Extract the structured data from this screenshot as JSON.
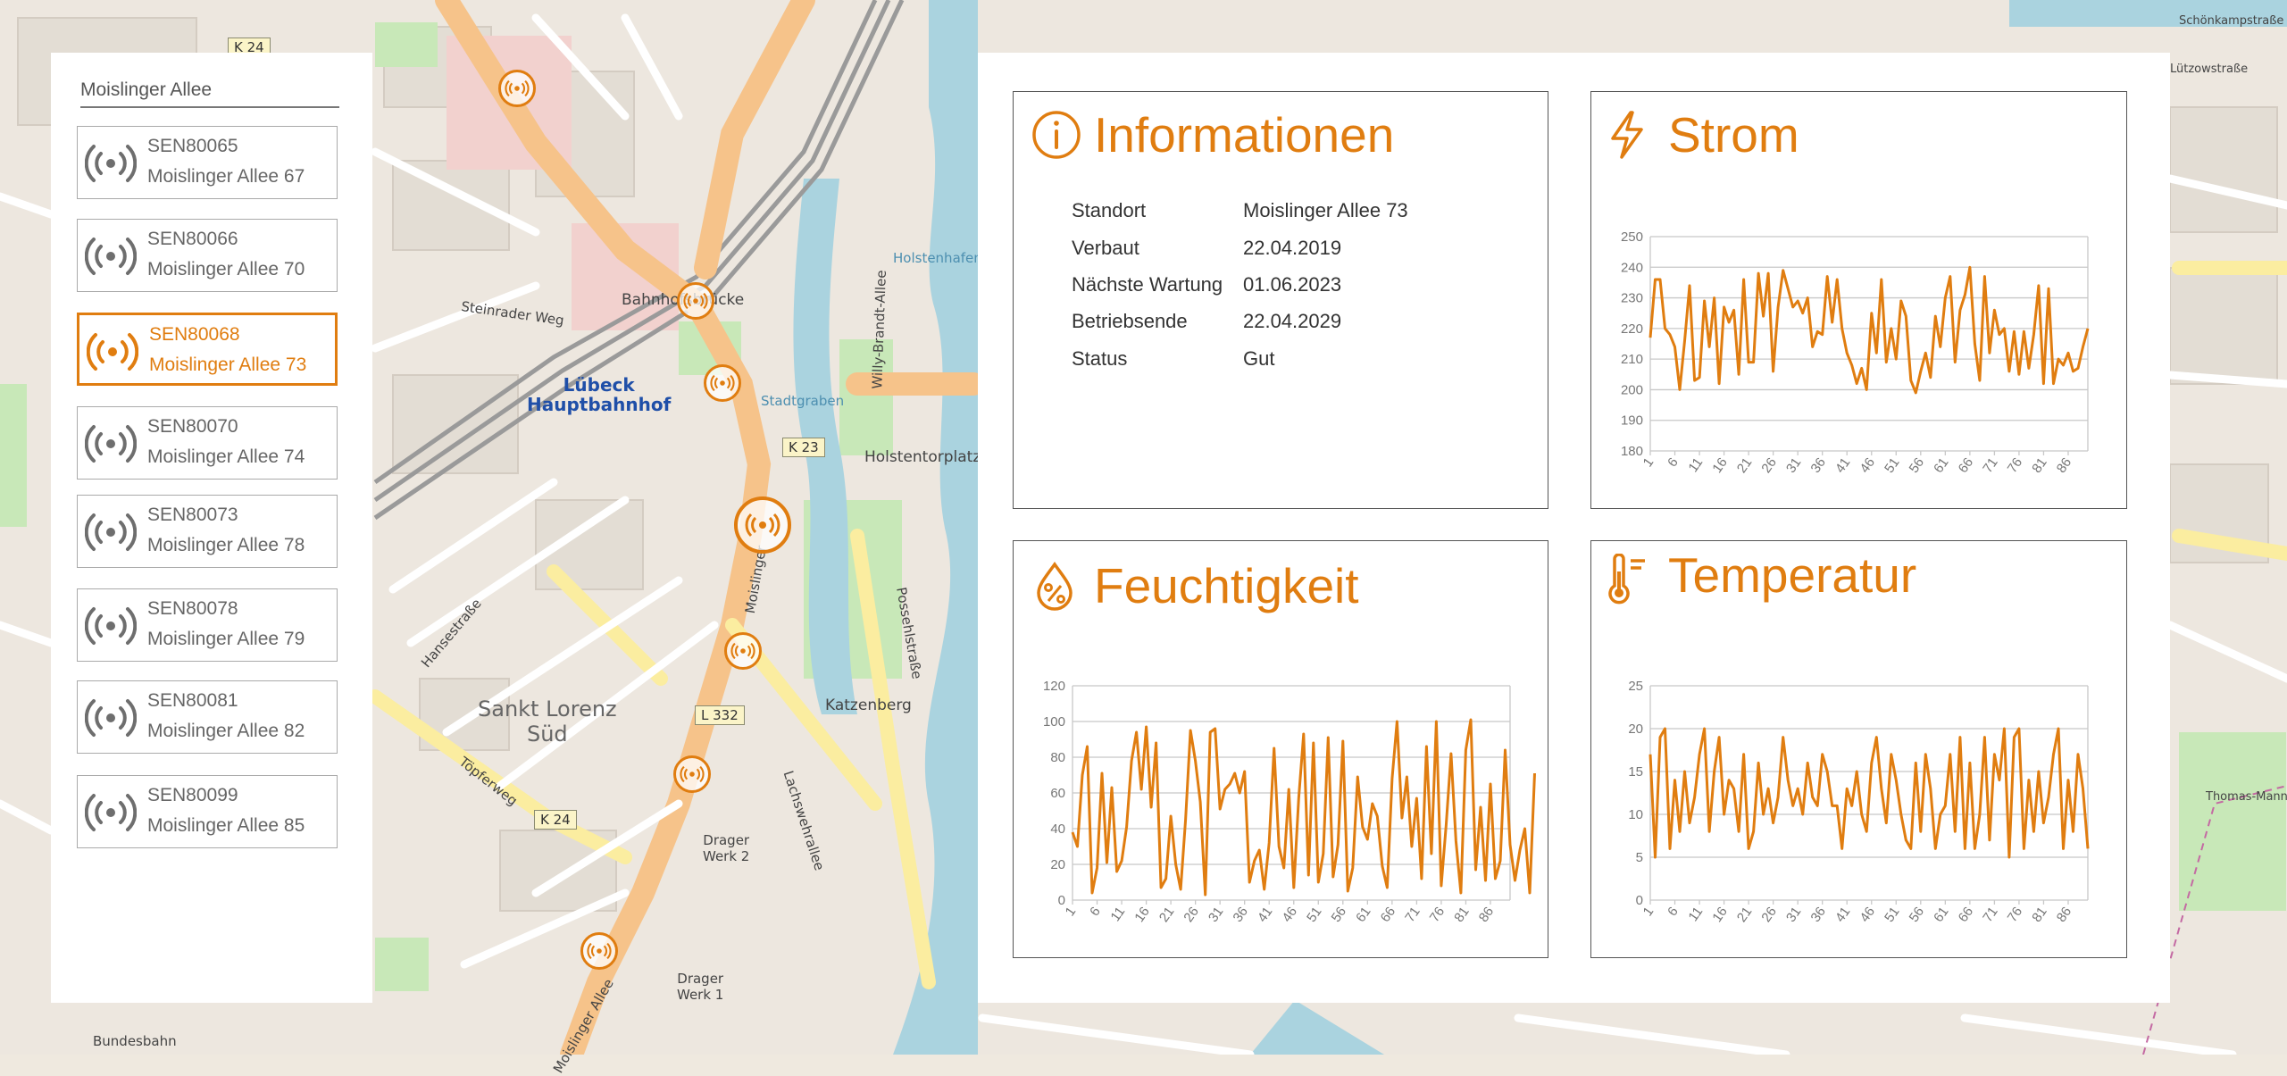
{
  "map": {
    "labels": {
      "luebeck_hbf_1": "Lübeck",
      "luebeck_hbf_2": "Hauptbahnhof",
      "sankt_lorenz_1": "Sankt Lorenz",
      "sankt_lorenz_2": "Süd",
      "drager_werk2_1": "Drager",
      "drager_werk2_2": "Werk 2",
      "drager_werk1_1": "Drager",
      "drager_werk1_2": "Werk 1",
      "holstentorplatz": "Holstentorplatz",
      "katzenberg": "Katzenberg",
      "bahnhofsbruecke": "Bahnhofsbrücke",
      "steinrader_weg": "Steinrader Weg",
      "hansestrasse": "Hansestraße",
      "topferweg": "Töpferweg",
      "lachswehrallee": "Lachswehrallee",
      "possehlstrasse": "Possehlstraße",
      "willy_brandt_allee": "Willy-Brandt-Allee",
      "stadtgraben": "Stadtgraben",
      "holstenhafen": "Holstenhafen",
      "moislinger": "Moislinger",
      "moislinger_allee_bottom": "Moislinger Allee",
      "thomas_mann": "Thomas-Mann-Straße",
      "bundesbahn": "Bundesbahn",
      "schoenkamp": "Schönkampstraße",
      "lutzowstrasse": "Lützowstraße",
      "k24_top": "K 24",
      "k23": "K 23",
      "l332": "L 332",
      "k24": "K 24"
    }
  },
  "sidebar": {
    "search_value": "Moislinger Allee",
    "sensors": [
      {
        "id": "SEN80065",
        "address": "Moislinger Allee 67",
        "active": false
      },
      {
        "id": "SEN80066",
        "address": "Moislinger Allee 70",
        "active": false
      },
      {
        "id": "SEN80068",
        "address": "Moislinger Allee 73",
        "active": true
      },
      {
        "id": "SEN80070",
        "address": "Moislinger Allee 74",
        "active": false
      },
      {
        "id": "SEN80073",
        "address": "Moislinger Allee 78",
        "active": false
      },
      {
        "id": "SEN80078",
        "address": "Moislinger Allee 79",
        "active": false
      },
      {
        "id": "SEN80081",
        "address": "Moislinger Allee 82",
        "active": false
      },
      {
        "id": "SEN80099",
        "address": "Moislinger Allee 85",
        "active": false
      }
    ]
  },
  "info": {
    "title": "Informationen",
    "icon": "info-icon",
    "rows": [
      {
        "label": "Standort",
        "value": "Moislinger Allee 73"
      },
      {
        "label": "Verbaut",
        "value": "22.04.2019"
      },
      {
        "label": "Nächste Wartung",
        "value": "01.06.2023"
      },
      {
        "label": "Betriebsende",
        "value": "22.04.2029"
      },
      {
        "label": "Status",
        "value": "Gut"
      }
    ]
  },
  "cards": {
    "strom": {
      "title": "Strom",
      "icon": "lightning-icon"
    },
    "feuchtigkeit": {
      "title": "Feuchtigkeit",
      "icon": "humidity-drop-icon"
    },
    "temperatur": {
      "title": "Temperatur",
      "icon": "thermometer-icon"
    }
  },
  "colors": {
    "accent": "#e07d10",
    "border": "#555555",
    "grid": "#c8c8c8"
  },
  "chart_data": [
    {
      "id": "strom",
      "type": "line",
      "ylim": [
        180,
        250
      ],
      "yticks": [
        180,
        190,
        200,
        210,
        220,
        230,
        240,
        250
      ],
      "xticks": [
        1,
        6,
        11,
        16,
        21,
        26,
        31,
        36,
        41,
        46,
        51,
        56,
        61,
        66,
        71,
        76,
        81,
        86
      ],
      "x_count": 90,
      "grid": true,
      "values": [
        217,
        236,
        236,
        220,
        218,
        214,
        200,
        216,
        234,
        203,
        204,
        229,
        214,
        230,
        202,
        227,
        222,
        226,
        205,
        236,
        209,
        209,
        238,
        224,
        238,
        206,
        227,
        239,
        233,
        227,
        229,
        225,
        230,
        214,
        219,
        218,
        237,
        222,
        236,
        220,
        212,
        208,
        202,
        207,
        200,
        225,
        212,
        236,
        209,
        220,
        210,
        229,
        224,
        203,
        199,
        206,
        212,
        204,
        224,
        214,
        230,
        237,
        209,
        226,
        231,
        240,
        215,
        203,
        237,
        212,
        226,
        218,
        220,
        206,
        219,
        205,
        219,
        207,
        218,
        234,
        202,
        233,
        202,
        210,
        208,
        212,
        206,
        207,
        214,
        220
      ]
    },
    {
      "id": "feuchtigkeit",
      "type": "line",
      "ylim": [
        0,
        120
      ],
      "yticks": [
        0,
        20,
        40,
        60,
        80,
        100,
        120
      ],
      "xticks": [
        1,
        6,
        11,
        16,
        21,
        26,
        31,
        36,
        41,
        46,
        51,
        56,
        61,
        66,
        71,
        76,
        81,
        86
      ],
      "x_count": 90,
      "grid": true,
      "values": [
        38,
        30,
        70,
        86,
        4,
        18,
        71,
        21,
        63,
        16,
        22,
        41,
        78,
        94,
        62,
        97,
        52,
        88,
        7,
        12,
        47,
        20,
        6,
        45,
        95,
        78,
        55,
        3,
        94,
        96,
        51,
        62,
        65,
        71,
        60,
        72,
        10,
        22,
        28,
        6,
        32,
        85,
        30,
        18,
        62,
        7,
        57,
        93,
        14,
        88,
        10,
        26,
        91,
        13,
        31,
        89,
        5,
        18,
        69,
        41,
        34,
        54,
        47,
        19,
        7,
        68,
        100,
        46,
        69,
        30,
        57,
        12,
        86,
        26,
        100,
        8,
        42,
        82,
        33,
        4,
        84,
        101,
        17,
        52,
        11,
        65,
        12,
        22,
        84,
        31,
        11,
        28,
        40,
        4,
        71
      ]
    },
    {
      "id": "temperatur",
      "type": "line",
      "ylim": [
        0,
        25
      ],
      "yticks": [
        0,
        5,
        10,
        15,
        20,
        25
      ],
      "xticks": [
        1,
        6,
        11,
        16,
        21,
        26,
        31,
        36,
        41,
        46,
        51,
        56,
        61,
        66,
        71,
        76,
        81,
        86
      ],
      "x_count": 90,
      "grid": true,
      "values": [
        17,
        5,
        19,
        20,
        6,
        14,
        8,
        15,
        9,
        12,
        17,
        20,
        8,
        15,
        19,
        10,
        14,
        13,
        8,
        17,
        6,
        8,
        16,
        10,
        13,
        9,
        12,
        19,
        14,
        11,
        13,
        10,
        16,
        12,
        11,
        17,
        15,
        11,
        11,
        6,
        13,
        11,
        15,
        10,
        8,
        16,
        19,
        13,
        9,
        17,
        14,
        10,
        7,
        6,
        16,
        8,
        17,
        13,
        6,
        10,
        11,
        17,
        8,
        19,
        6,
        16,
        6,
        10,
        19,
        7,
        17,
        14,
        20,
        5,
        19,
        20,
        6,
        14,
        8,
        15,
        9,
        12,
        17,
        20,
        6,
        14,
        8,
        17,
        13,
        6
      ]
    }
  ]
}
